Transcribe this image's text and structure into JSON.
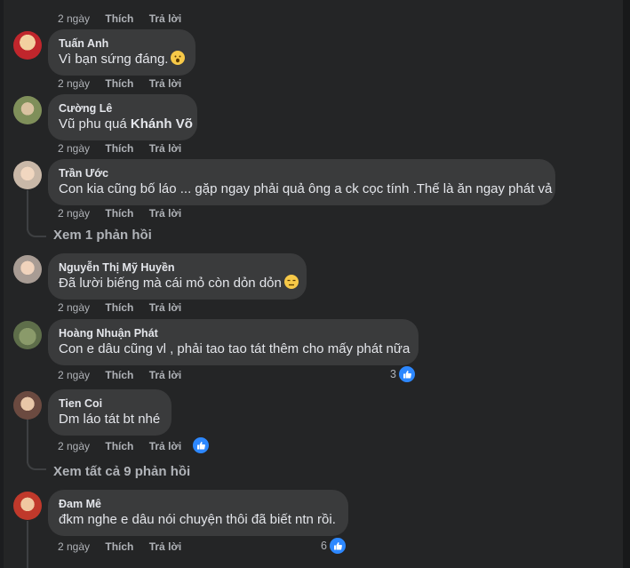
{
  "comments": [
    {
      "name": "",
      "text": "",
      "time": "2 ngày",
      "like": "Thích",
      "reply": "Trả lời"
    },
    {
      "name": "Tuấn Anh",
      "text": "Vì bạn sứng đáng.",
      "time": "2 ngày",
      "like": "Thích",
      "reply": "Trả lời",
      "emoji": "hushed-face-icon"
    },
    {
      "name": "Cường Lê",
      "text": "Vũ phu quá",
      "tag": "Khánh Võ",
      "time": "2 ngày",
      "like": "Thích",
      "reply": "Trả lời"
    },
    {
      "name": "Trần Ước",
      "text": "Con kia cũng bố láo ... gặp ngay phải quả ông a ck cọc tính .Thế là ăn ngay phát vả",
      "time": "2 ngày",
      "like": "Thích",
      "reply": "Trả lời",
      "view_replies": "Xem 1 phản hồi"
    },
    {
      "name": "Nguyễn Thị Mỹ Huyền",
      "text": "Đã lười biếng mà cái mỏ còn dỏn dỏn",
      "time": "2 ngày",
      "like": "Thích",
      "reply": "Trả lời",
      "emoji": "unamused-face-icon"
    },
    {
      "name": "Hoàng Nhuận Phát",
      "text": "Con e dâu cũng vl , phải tao tao tát thêm cho mấy phát nữa",
      "time": "2 ngày",
      "like": "Thích",
      "reply": "Trả lời",
      "reactions": "3"
    },
    {
      "name": "Tien Coi",
      "text": "Dm láo tát bt nhé",
      "time": "2 ngày",
      "like": "Thích",
      "reply": "Trả lời",
      "reactions": "",
      "view_replies": "Xem tất cả 9 phản hồi"
    },
    {
      "name": "Đam Mê",
      "text": "đkm nghe e dâu nói chuyện thôi đã biết ntn rồi.",
      "time": "2 ngày",
      "like": "Thích",
      "reply": "Trả lời",
      "reactions": "6"
    }
  ],
  "colors": {
    "background": "#242526",
    "bubble": "#3a3b3c",
    "text": "#e4e6eb",
    "secondary": "#b0b3b8",
    "like_blue": "#2d88ff"
  }
}
